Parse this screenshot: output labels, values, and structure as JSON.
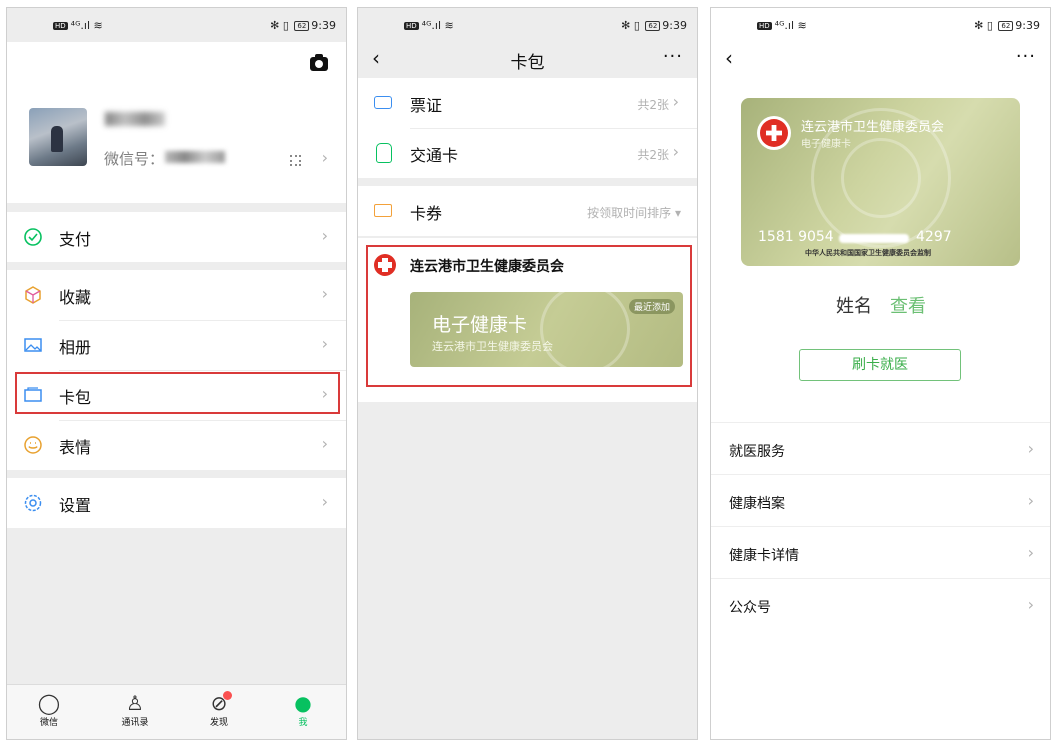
{
  "status_bar": {
    "left": " ⁠⁠⁴ᴳ.ıl ⁠◉",
    "hd": "HD",
    "right_icons": "✻ ▯ ",
    "battery": "62",
    "time": "9:39"
  },
  "panel_me": {
    "wechat_id_label": "微信号：",
    "menu": [
      {
        "label": "支付",
        "icon": "pay-icon"
      },
      {
        "label": "收藏",
        "icon": "favorites-icon"
      },
      {
        "label": "相册",
        "icon": "album-icon"
      },
      {
        "label": "卡包",
        "icon": "card-wallet-icon"
      },
      {
        "label": "表情",
        "icon": "sticker-icon"
      },
      {
        "label": "设置",
        "icon": "settings-icon"
      }
    ],
    "tabs": [
      {
        "label": "微信",
        "icon": "chat-icon"
      },
      {
        "label": "通讯录",
        "icon": "contacts-icon"
      },
      {
        "label": "发现",
        "icon": "discover-icon"
      },
      {
        "label": "我",
        "icon": "me-icon",
        "active": true
      }
    ]
  },
  "panel_wallet": {
    "title": "卡包",
    "more": "···",
    "items": [
      {
        "label": "票证",
        "count": "共2张",
        "icon": "ticket-icon"
      },
      {
        "label": "交通卡",
        "count": "共2张",
        "icon": "bus-icon"
      }
    ],
    "coupons": {
      "label": "卡券",
      "sort": "按领取时间排序 ▾",
      "icon": "coupon-icon"
    },
    "card_issuer": "连云港市卫生健康委员会",
    "card_title": "电子健康卡",
    "card_sub": "连云港市卫生健康委员会",
    "card_badge": "最近添加"
  },
  "panel_card": {
    "more": "···",
    "org": "连云港市卫生健康委员会",
    "org_sub": "电子健康卡",
    "num_left": "1581 9054",
    "num_right": "4297",
    "supervise": "中华人民共和国国家卫生健康委员会监制",
    "name_label": "姓名",
    "view_label": "查看",
    "swipe_button": "刷卡就医",
    "services": [
      "就医服务",
      "健康档案",
      "健康卡详情",
      "公众号"
    ]
  },
  "colors": {
    "accent": "#07c160",
    "highlight": "#d93a3a",
    "card_green": "#b3bb82"
  }
}
